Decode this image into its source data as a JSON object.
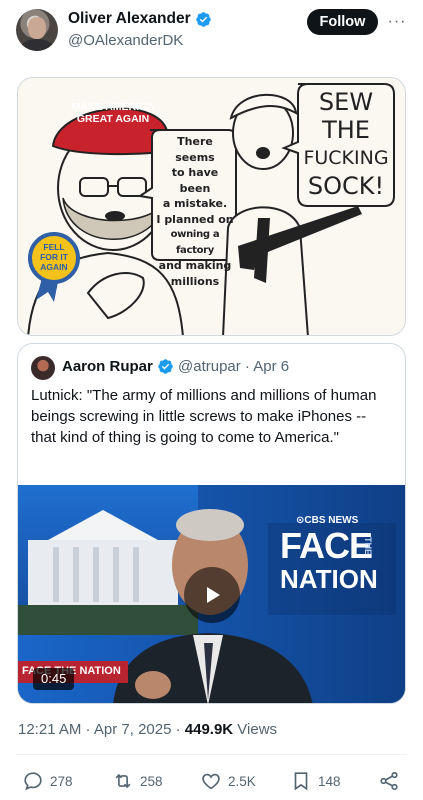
{
  "author": {
    "name": "Oliver Alexander",
    "handle": "@OAlexanderDK",
    "follow_label": "Follow",
    "more_label": "···"
  },
  "comic": {
    "hat_text": "MAKE AMERICA GREAT AGAIN",
    "speech_left": [
      "There seems",
      "to have been",
      "a mistake.",
      "I planned on",
      "owning a factory",
      "and making",
      "millions"
    ],
    "speech_right": [
      "SEW",
      "THE",
      "FUCKING",
      "SOCK!"
    ],
    "badge_text": [
      "FELL",
      "FOR IT",
      "AGAIN"
    ]
  },
  "quote": {
    "name": "Aaron Rupar",
    "handle_date": "@atrupar · Apr 6",
    "text": "Lutnick: \"The army of millions and millions of human beings screwing in little screws to make iPhones -- that kind of thing is going to come to America.\"",
    "video": {
      "network_label": "⊙CBS NEWS",
      "show_line1": "FACE",
      "show_line2": "NATION",
      "show_the": "THE",
      "lower_third": "FACE THE NATION",
      "duration": "0:45"
    }
  },
  "meta": {
    "time_date": "12:21 AM · Apr 7, 2025 · ",
    "views_count": "449.9K",
    "views_label": " Views"
  },
  "actions": {
    "replies": "278",
    "reposts": "258",
    "likes": "2.5K",
    "bookmarks": "148"
  },
  "colors": {
    "verified": "#1d9bf0",
    "text_secondary": "#536471",
    "hat_red": "#c8232c",
    "badge_blue": "#2f5fa7",
    "badge_yellow": "#f4c21b"
  }
}
